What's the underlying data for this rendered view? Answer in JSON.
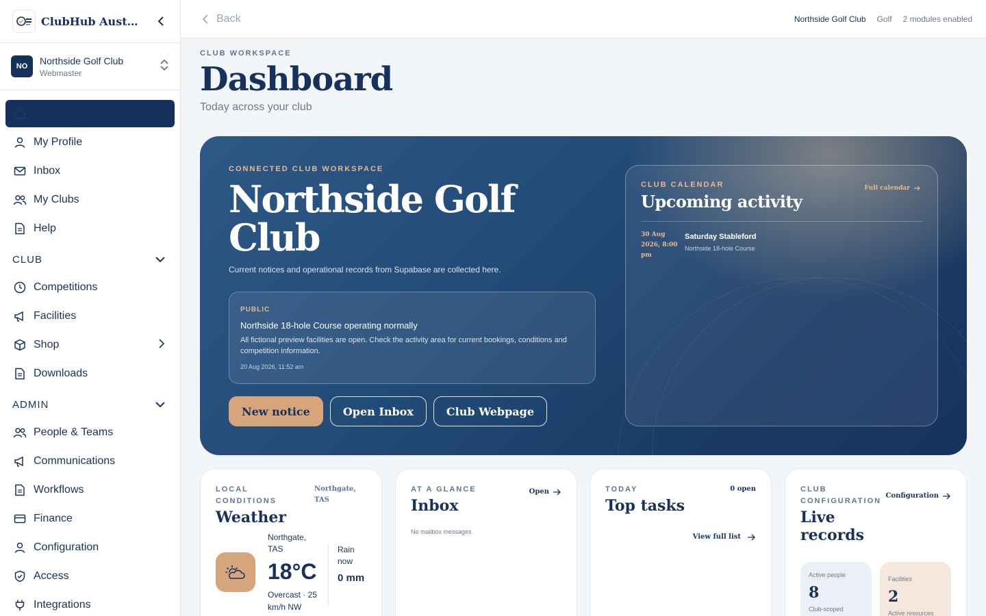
{
  "sidebar": {
    "brand": "ClubHub Australia",
    "club": {
      "initials": "NO",
      "name": "Northside Golf Club",
      "role": "Webmaster"
    },
    "items": [
      {
        "label": "Dashboard"
      },
      {
        "label": "My Profile"
      },
      {
        "label": "Inbox"
      },
      {
        "label": "My Clubs"
      },
      {
        "label": "Help"
      }
    ],
    "club_section": "CLUB",
    "club_items": [
      {
        "label": "Competitions"
      },
      {
        "label": "Facilities"
      },
      {
        "label": "Shop"
      },
      {
        "label": "Downloads"
      }
    ],
    "admin_section": "ADMIN",
    "admin_items": [
      {
        "label": "People & Teams"
      },
      {
        "label": "Communications"
      },
      {
        "label": "Workflows"
      },
      {
        "label": "Finance"
      },
      {
        "label": "Configuration"
      },
      {
        "label": "Access"
      },
      {
        "label": "Integrations"
      }
    ]
  },
  "topbar": {
    "back": "Back",
    "club": "Northside Golf Club",
    "sport": "Golf",
    "modules": "2 modules enabled"
  },
  "header": {
    "eyebrow": "CLUB WORKSPACE",
    "title": "Dashboard",
    "subtitle": "Today across your club"
  },
  "hero": {
    "eyebrow": "CONNECTED CLUB WORKSPACE",
    "title": "Northside Golf Club",
    "description": "Current notices and operational records from Supabase are collected here.",
    "notice": {
      "tag": "PUBLIC",
      "title": "Northside 18-hole Course operating normally",
      "body": "All fictional preview facilities are open. Check the activity area for current bookings, conditions and competition information.",
      "date": "20 Aug 2026, 11:52 am"
    },
    "buttons": {
      "new_notice": "New notice",
      "open_inbox": "Open Inbox",
      "webpage": "Club Webpage"
    },
    "calendar": {
      "eyebrow": "CLUB CALENDAR",
      "link": "Full calendar",
      "title": "Upcoming activity",
      "event": {
        "date": "30 Aug 2026, 8:00 pm",
        "title": "Saturday Stableford",
        "location": "Northside 18-hole Course"
      }
    }
  },
  "cards": {
    "weather": {
      "eyebrow": "LOCAL CONDITIONS",
      "location_tag": "Northgate, TAS",
      "title": "Weather",
      "place": "Northgate, TAS",
      "temp": "18°C",
      "condition": "Overcast · 25 km/h NW",
      "rain_label": "Rain now",
      "rain_value": "0 mm"
    },
    "inbox": {
      "eyebrow": "AT A GLANCE",
      "title": "Inbox",
      "link": "Open",
      "empty": "No mailbox messages."
    },
    "tasks": {
      "eyebrow": "TODAY",
      "title": "Top tasks",
      "count": "0 open",
      "link": "View full list"
    },
    "records": {
      "eyebrow": "CLUB CONFIGURATION",
      "title": "Live records",
      "link": "Configuration",
      "stats": [
        {
          "label": "Active people",
          "value": "8",
          "sub": "Club-scoped"
        },
        {
          "label": "Facilities",
          "value": "2",
          "sub": "Active resources"
        }
      ]
    }
  },
  "colors": {
    "navy": "#16325c",
    "accent": "#d7a57c",
    "hero": "#234b78"
  }
}
